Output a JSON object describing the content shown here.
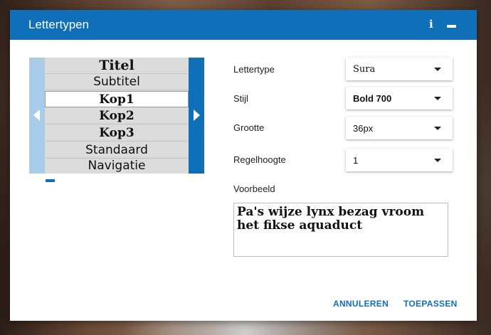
{
  "dialog": {
    "title": "Lettertypen",
    "info_icon_glyph": "i",
    "icons": [
      "info-icon",
      "minimize-icon",
      "chevron-left-icon",
      "chevron-right-icon",
      "caret-down-icon"
    ]
  },
  "slider": {
    "items": [
      "Titel",
      "Subtitel",
      "Kop1",
      "Kop2",
      "Kop3",
      "Standaard",
      "Navigatie"
    ],
    "selected": "Kop1"
  },
  "form": {
    "font_label": "Lettertype",
    "font_value": "Sura",
    "style_label": "Stijl",
    "style_value": "Bold 700",
    "size_label": "Grootte",
    "size_value": "36px",
    "lineheight_label": "Regelhoogte",
    "lineheight_value": "1",
    "preview_label": "Voorbeeld",
    "preview_text": "Pa's wijze lynx bezag vroom het fikse aquaduct"
  },
  "actions": {
    "cancel_label": "ANNULEREN",
    "apply_label": "TOEPASSEN"
  },
  "colors": {
    "accent": "#0f6fb8",
    "accent_light": "#a9cde8"
  }
}
